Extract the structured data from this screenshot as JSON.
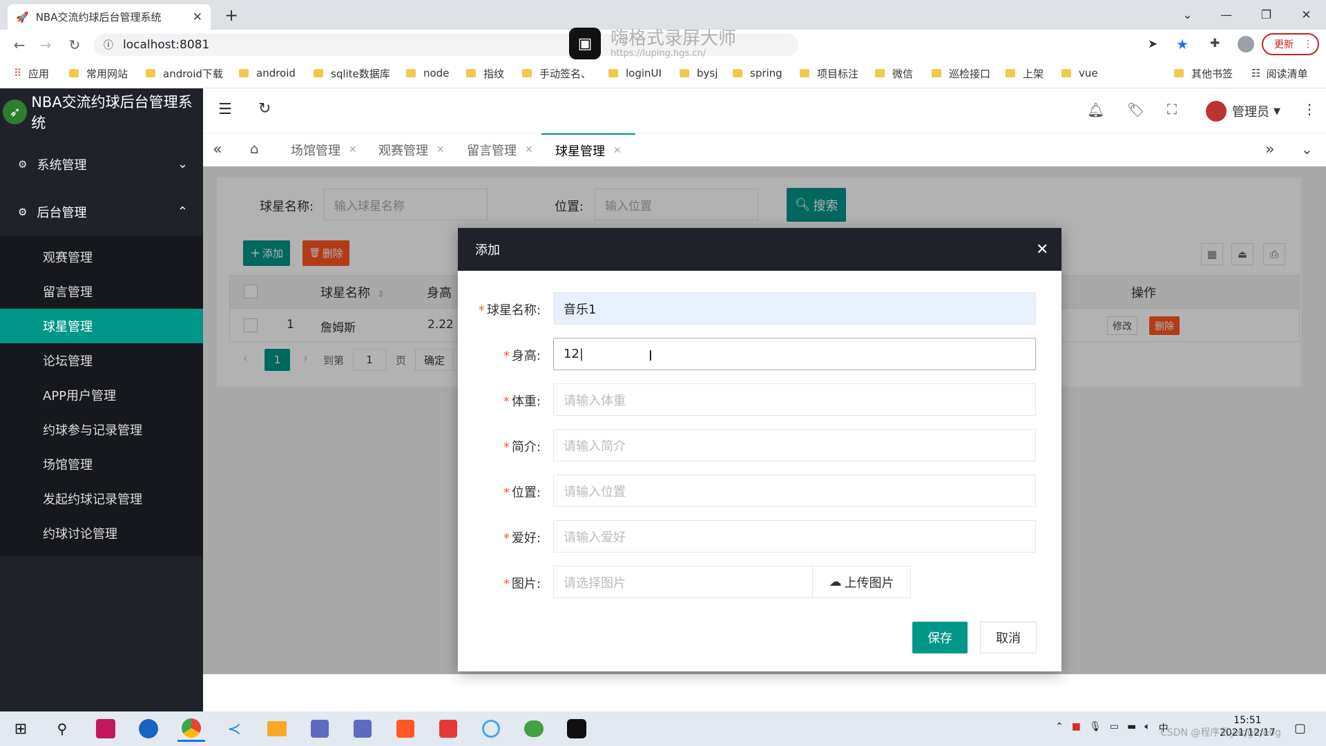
{
  "browser": {
    "tab_title": "NBA交流约球后台管理系统",
    "url": "localhost:8081",
    "update_label": "更新",
    "bookmarks": [
      "应用",
      "常用网站",
      "android下载",
      "android",
      "sqlite数据库",
      "node",
      "指纹",
      "手动签名、",
      "loginUI",
      "bysj",
      "spring",
      "项目标注",
      "微信",
      "巡检接口",
      "上架",
      "vue"
    ],
    "other_bookmarks": "其他书签",
    "reading_list": "阅读清单"
  },
  "watermark": {
    "title": "嗨格式录屏大师",
    "url": "https://luping.hgs.cn/"
  },
  "app": {
    "title": "NBA交流约球后台管理系统",
    "user": "管理员",
    "menu": {
      "group1": "系统管理",
      "group2": "后台管理",
      "items": [
        "观赛管理",
        "留言管理",
        "球星管理",
        "论坛管理",
        "APP用户管理",
        "约球参与记录管理",
        "场馆管理",
        "发起约球记录管理",
        "约球讨论管理"
      ]
    },
    "page_tabs": [
      "场馆管理",
      "观赛管理",
      "留言管理",
      "球星管理"
    ],
    "search": {
      "name_label": "球星名称:",
      "name_placeholder": "输入球星名称",
      "pos_label": "位置:",
      "pos_placeholder": "输入位置",
      "button": "搜索"
    },
    "toolbar": {
      "add": "添加",
      "delete": "删除"
    },
    "table": {
      "headers": [
        "球星名称",
        "身高",
        "操作"
      ],
      "rows": [
        {
          "index": "1",
          "name": "詹姆斯",
          "height": "2.22",
          "edit": "修改",
          "del": "删除"
        }
      ]
    },
    "pager": {
      "page": "1",
      "goto": "到第",
      "page_input": "1",
      "page_unit": "页",
      "confirm": "确定"
    }
  },
  "dialog": {
    "title": "添加",
    "fields": [
      {
        "label": "球星名称:",
        "value": "音乐1",
        "placeholder": ""
      },
      {
        "label": "身高:",
        "value": "12",
        "placeholder": ""
      },
      {
        "label": "体重:",
        "value": "",
        "placeholder": "请输入体重"
      },
      {
        "label": "简介:",
        "value": "",
        "placeholder": "请输入简介"
      },
      {
        "label": "位置:",
        "value": "",
        "placeholder": "请输入位置"
      },
      {
        "label": "爱好:",
        "value": "",
        "placeholder": "请输入爱好"
      },
      {
        "label": "图片:",
        "value": "",
        "placeholder": "请选择图片"
      }
    ],
    "upload": "上传图片",
    "save": "保存",
    "cancel": "取消"
  },
  "taskbar": {
    "time": "15:51",
    "date": "2021/12/17",
    "csdn": "CSDN @程序员yangmeng"
  }
}
